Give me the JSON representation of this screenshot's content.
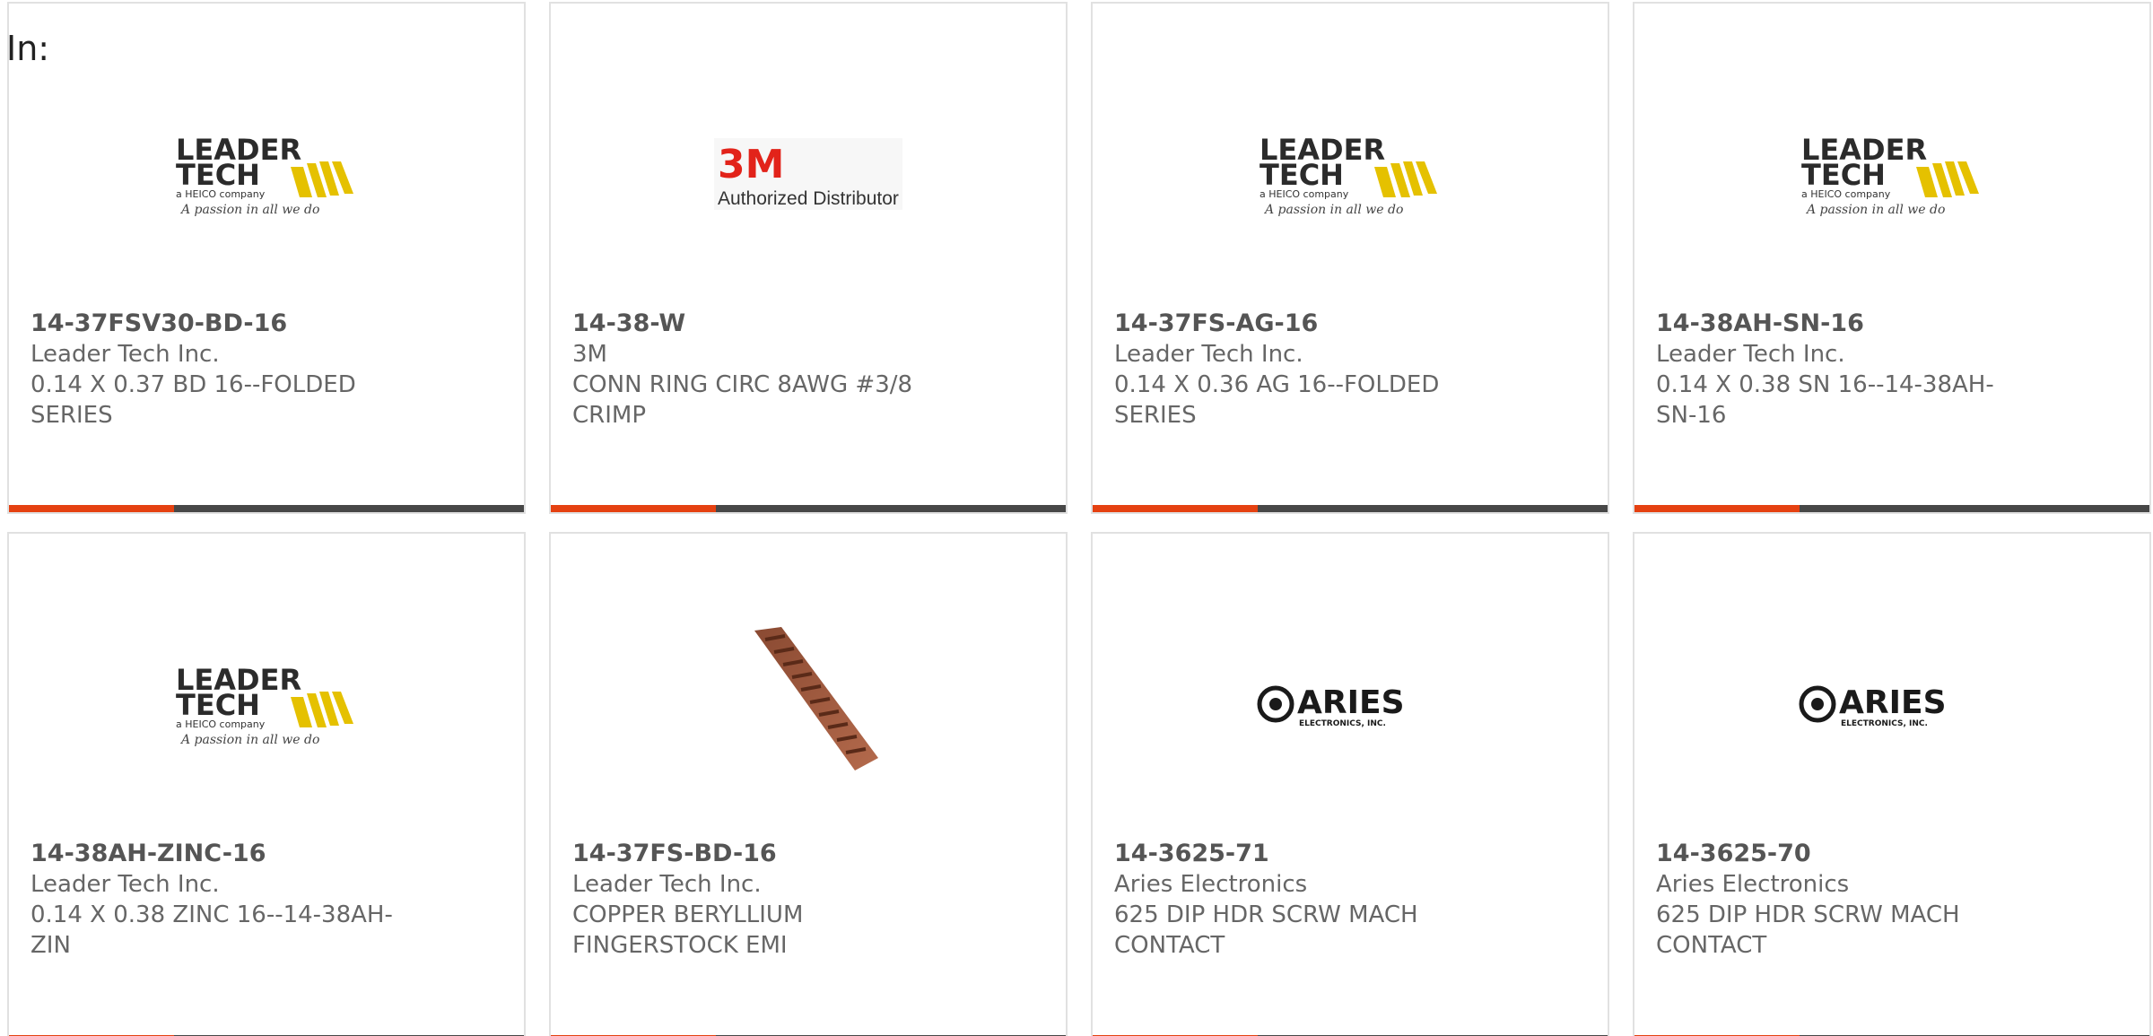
{
  "filter": {
    "label": "In:"
  },
  "colors": {
    "accent": "#e54111",
    "bar": "#474747",
    "border": "#e1e1e1"
  },
  "cards": [
    {
      "part": "14-37FSV30-BD-16",
      "manufacturer": "Leader Tech Inc.",
      "description": "0.14 X 0.37 BD 16--FOLDED SERIES",
      "logo": "leader-tech-logo"
    },
    {
      "part": "14-38-W",
      "manufacturer": "3M",
      "description": "CONN RING CIRC 8AWG #3/8 CRIMP",
      "logo": "3m-authorized-distributor-logo",
      "logo_text": {
        "mark": "3M",
        "caption": "Authorized Distributor"
      }
    },
    {
      "part": "14-37FS-AG-16",
      "manufacturer": "Leader Tech Inc.",
      "description": "0.14 X 0.36 AG 16--FOLDED SERIES",
      "logo": "leader-tech-logo"
    },
    {
      "part": "14-38AH-SN-16",
      "manufacturer": "Leader Tech Inc.",
      "description": "0.14 X 0.38 SN 16--14-38AH-SN-16",
      "logo": "leader-tech-logo"
    },
    {
      "part": "14-38AH-ZINC-16",
      "manufacturer": "Leader Tech Inc.",
      "description": "0.14 X 0.38 ZINC 16--14-38AH-ZIN",
      "logo": "leader-tech-logo"
    },
    {
      "part": "14-37FS-BD-16",
      "manufacturer": "Leader Tech Inc.",
      "description": "COPPER BERYLLIUM FINGERSTOCK EMI",
      "logo": "fingerstock-photo"
    },
    {
      "part": "14-3625-71",
      "manufacturer": "Aries Electronics",
      "description": "625 DIP HDR SCRW MACH CONTACT",
      "logo": "aries-electronics-logo"
    },
    {
      "part": "14-3625-70",
      "manufacturer": "Aries Electronics",
      "description": "625 DIP HDR SCRW MACH CONTACT",
      "logo": "aries-electronics-logo"
    }
  ],
  "logos": {
    "leader_tech": {
      "line1": "LEADER",
      "line2": "TECH",
      "tagline1": "a HEICO company",
      "tagline2": "A passion in all we do"
    },
    "aries": {
      "name": "ARIES",
      "sub": "ELECTRONICS, INC."
    }
  }
}
